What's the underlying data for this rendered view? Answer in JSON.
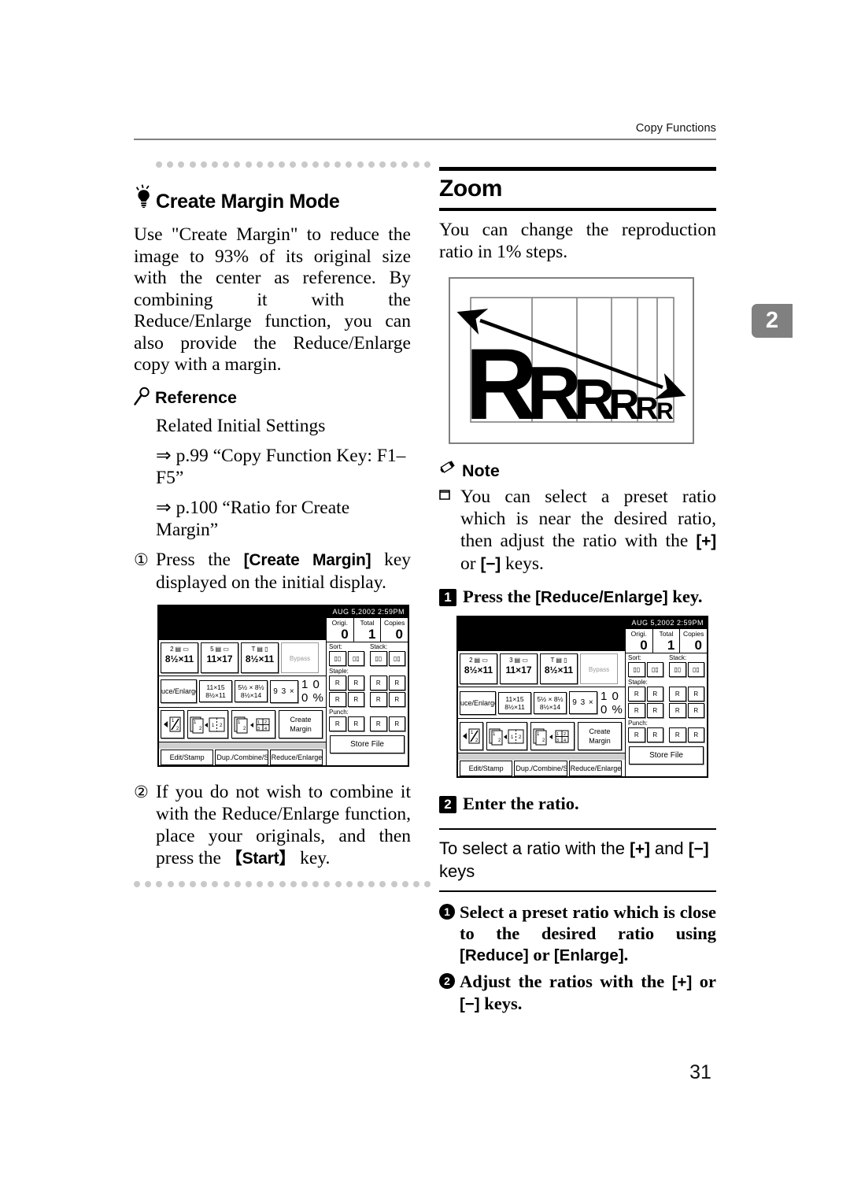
{
  "header": {
    "running_head": "Copy Functions",
    "chapter_tab": "2",
    "page_number": "31"
  },
  "left_column": {
    "tip_title": "Create Margin Mode",
    "tip_icon": "lightbulb-icon",
    "body_paragraph": "Use \"Create Margin\" to reduce the image to 93% of its original size with the center as reference. By combining it with the Reduce/Enlarge function, you can also provide the Reduce/Enlarge copy with a margin.",
    "reference": {
      "icon": "magnifier-icon",
      "heading": "Reference",
      "line1": "Related Initial Settings",
      "line2": "⇒ p.99 “Copy Function Key: F1–F5”",
      "line3": "⇒ p.100 “Ratio for Create Margin”"
    },
    "steps": [
      {
        "marker": "①",
        "text_before": "Press the ",
        "key": "[Create Margin]",
        "text_after": " key displayed on the initial display."
      },
      {
        "marker": "②",
        "text_before": "If you do not wish to combine it with the Reduce/Enlarge function, place your originals, and then press the ",
        "key": "【Start】",
        "text_after": " key."
      }
    ]
  },
  "right_column": {
    "section_title": "Zoom",
    "intro": "You can change the reproduction ratio in 1% steps.",
    "figure": {
      "name": "zoom-ratio-illustration",
      "letters": [
        "R",
        "R",
        "R",
        "R",
        "R",
        "R"
      ],
      "arrow": "double-headed-diagonal-arrow"
    },
    "note": {
      "icon": "pencil-icon",
      "heading": "Note",
      "bullet": "❑",
      "text_a": "You can select a preset ratio which is near the desired ratio, then adjust the ratio with the ",
      "key_plus": "[+]",
      "text_b": " or ",
      "key_minus": "[−]",
      "text_c": " keys."
    },
    "step1": {
      "num": "1",
      "text_before": "Press the ",
      "key": "[Reduce/Enlarge]",
      "text_after": " key."
    },
    "step2": {
      "num": "2",
      "text": "Enter the ratio."
    },
    "subsection": {
      "text_before": "To select a ratio with the ",
      "key_plus": "[+]",
      "text_mid": " and ",
      "key_minus": "[−]",
      "text_after": " keys"
    },
    "substeps": [
      {
        "num": "1",
        "text_before": "Select a preset ratio which is close to the desired ratio using ",
        "key_a": "[Reduce]",
        "text_mid": " or ",
        "key_b": "[Enlarge]",
        "text_after": "."
      },
      {
        "num": "2",
        "text_before": "Adjust the ratios with the ",
        "key_a": "[+]",
        "text_mid": " or ",
        "key_b": "[−]",
        "text_after": " keys."
      }
    ]
  },
  "lcd_panel_1": {
    "name": "copier-initial-display-screenshot-1",
    "datetime": "AUG   5,2002   2:59PM",
    "counters": [
      {
        "label": "Origi.",
        "value": "0"
      },
      {
        "label": "Total",
        "value": "1"
      },
      {
        "label": "Copies",
        "value": "0"
      }
    ],
    "trays": [
      {
        "num": "2",
        "size": "8½×11"
      },
      {
        "num": "5",
        "size": "11×17"
      },
      {
        "num": "T",
        "size": "8½×11"
      },
      {
        "num": "",
        "size": "Bypass"
      }
    ],
    "reduce_enlarge_label": "uce/Enlarge",
    "ratio_presets": [
      {
        "l1": "11×15",
        "l2": "8½×11"
      },
      {
        "l1": "5½ × 8½",
        "l2": "8½×14"
      }
    ],
    "ratio_93": "9 3 ×",
    "ratio_current": "1 0 0 %",
    "create_margin_btn": "Create\nMargin",
    "finishing": {
      "sort": "Sort:",
      "stack": "Stack:",
      "staple": "Staple:",
      "punch": "Punch:"
    },
    "store_file": "Store File",
    "tabs": [
      "Edit/Stamp",
      "Dup./Combine/Series",
      "Reduce/Enlarge"
    ]
  },
  "lcd_panel_2": {
    "name": "copier-initial-display-screenshot-2",
    "datetime": "AUG   5,2002   2:59PM",
    "counters": [
      {
        "label": "Origi.",
        "value": "0"
      },
      {
        "label": "Total",
        "value": "1"
      },
      {
        "label": "Copies",
        "value": "0"
      }
    ],
    "trays": [
      {
        "num": "2",
        "size": "8½×11"
      },
      {
        "num": "3",
        "size": "11×17"
      },
      {
        "num": "T",
        "size": "8½×11"
      },
      {
        "num": "",
        "size": "Bypass"
      }
    ],
    "reduce_enlarge_label": "uce/Enlarge",
    "ratio_presets": [
      {
        "l1": "11×15",
        "l2": "8½×11"
      },
      {
        "l1": "5½ × 8½",
        "l2": "8½×14"
      }
    ],
    "ratio_93": "9 3 ×",
    "ratio_current": "1 0 0 %",
    "create_margin_btn": "Create\nMargin",
    "finishing": {
      "sort": "Sort:",
      "stack": "Stack:",
      "staple": "Staple:",
      "punch": "Punch:"
    },
    "store_file": "Store File",
    "tabs": [
      "Edit/Stamp",
      "Dup./Combine/Series",
      "Reduce/Enlarge"
    ]
  }
}
